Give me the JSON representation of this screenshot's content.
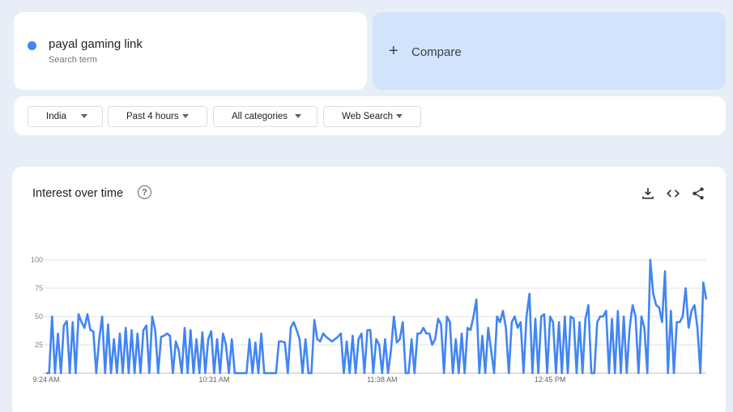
{
  "search_term": {
    "name": "payal gaming link",
    "subtitle": "Search term",
    "color": "#4285f4"
  },
  "compare": {
    "label": "Compare",
    "plus": "+"
  },
  "filters": {
    "region": "India",
    "time_range": "Past 4 hours",
    "category": "All categories",
    "property": "Web Search"
  },
  "chart_section": {
    "title": "Interest over time",
    "help": "?"
  },
  "icons": {
    "download": "download-icon",
    "embed": "embed-icon",
    "share": "share-icon",
    "help": "help-icon"
  },
  "chart_data": {
    "type": "line",
    "y_ticks": [
      25,
      50,
      75,
      100
    ],
    "ylim": [
      0,
      100
    ],
    "x_tick_labels": [
      "9:24 AM",
      "10:31 AM",
      "11:38 AM",
      "12:45 PM"
    ],
    "x_tick_index": [
      0,
      57,
      114,
      171
    ],
    "line_color": "#4285f4",
    "grid": true,
    "series": [
      {
        "values": [
          0,
          0,
          50,
          0,
          35,
          0,
          42,
          46,
          0,
          45,
          0,
          52,
          45,
          40,
          52,
          38,
          37,
          0,
          30,
          50,
          0,
          43,
          0,
          30,
          0,
          35,
          0,
          40,
          0,
          38,
          0,
          35,
          0,
          38,
          42,
          0,
          50,
          38,
          0,
          32,
          33,
          35,
          33,
          0,
          28,
          20,
          0,
          40,
          0,
          38,
          0,
          30,
          0,
          36,
          0,
          30,
          37,
          0,
          30,
          0,
          35,
          25,
          0,
          30,
          0,
          0,
          0,
          0,
          0,
          30,
          0,
          27,
          0,
          35,
          0,
          0,
          0,
          0,
          0,
          28,
          28,
          27,
          0,
          40,
          45,
          38,
          30,
          0,
          30,
          0,
          0,
          47,
          30,
          28,
          35,
          32,
          30,
          28,
          30,
          32,
          35,
          0,
          28,
          0,
          33,
          0,
          30,
          35,
          0,
          38,
          38,
          0,
          30,
          25,
          0,
          30,
          0,
          20,
          50,
          27,
          30,
          45,
          0,
          0,
          30,
          0,
          35,
          35,
          40,
          35,
          35,
          25,
          30,
          48,
          43,
          0,
          50,
          45,
          0,
          30,
          0,
          35,
          0,
          40,
          38,
          50,
          65,
          0,
          33,
          0,
          40,
          20,
          0,
          50,
          45,
          55,
          40,
          0,
          45,
          50,
          40,
          45,
          0,
          50,
          70,
          0,
          48,
          0,
          50,
          52,
          0,
          50,
          45,
          0,
          45,
          0,
          50,
          0,
          50,
          48,
          0,
          45,
          0,
          48,
          60,
          0,
          0,
          45,
          50,
          50,
          55,
          0,
          48,
          0,
          55,
          0,
          50,
          0,
          40,
          60,
          50,
          0,
          50,
          40,
          0,
          100,
          70,
          60,
          58,
          45,
          90,
          0,
          55,
          0,
          45,
          45,
          50,
          75,
          40,
          55,
          60,
          40,
          0,
          80,
          65
        ]
      }
    ]
  }
}
